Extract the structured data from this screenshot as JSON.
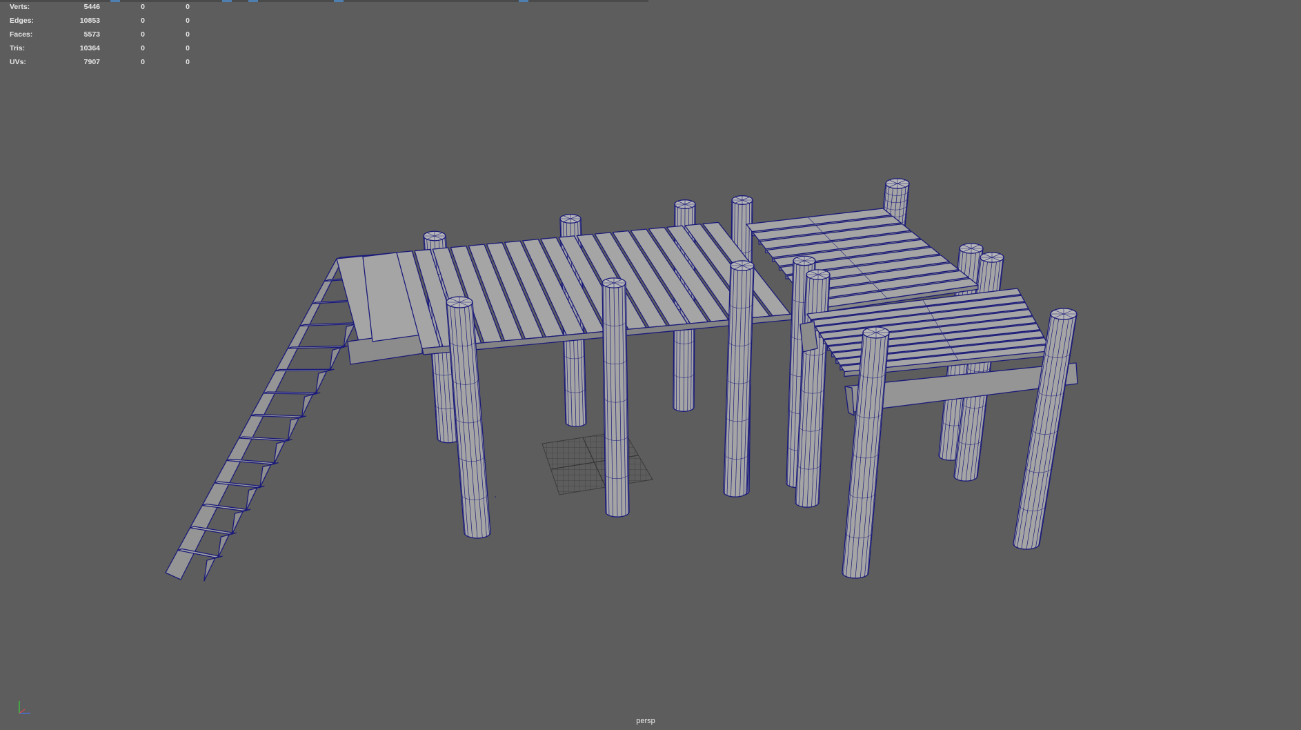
{
  "viewport": {
    "camera": "persp",
    "background_color": "#5d5d5d",
    "wireframe_color": "#1a1a7a",
    "mesh_color": "#a5a5a5"
  },
  "hud": {
    "rows": [
      {
        "label": "Verts:",
        "v1": "5446",
        "v2": "0",
        "v3": "0"
      },
      {
        "label": "Edges:",
        "v1": "10853",
        "v2": "0",
        "v3": "0"
      },
      {
        "label": "Faces:",
        "v1": "5573",
        "v2": "0",
        "v3": "0"
      },
      {
        "label": "Tris:",
        "v1": "10364",
        "v2": "0",
        "v3": "0"
      },
      {
        "label": "UVs:",
        "v1": "7907",
        "v2": "0",
        "v3": "0"
      }
    ]
  },
  "scene": {
    "object": "wooden-dock-mesh",
    "axis_gizmo": "xyz-axis-icon"
  }
}
